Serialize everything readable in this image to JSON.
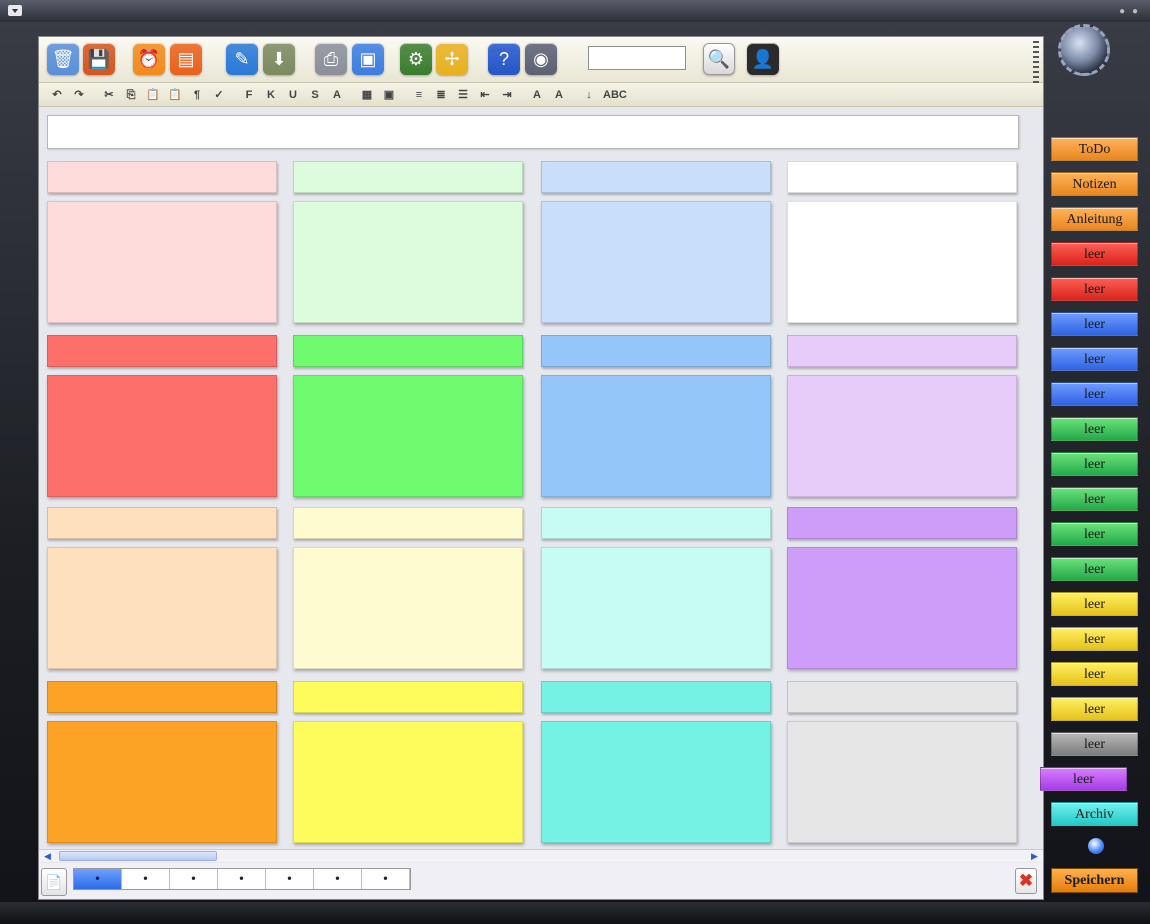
{
  "toolbar": {
    "icons": [
      {
        "name": "trash-icon",
        "glyph": "🗑",
        "color": "#5a8fd8"
      },
      {
        "name": "save-icon",
        "glyph": "💾",
        "color": "#d6551e"
      },
      {
        "name": "alarm-icon",
        "glyph": "⏰",
        "color": "#f28a1b"
      },
      {
        "name": "calendar-icon",
        "glyph": "▤",
        "color": "#e9621b"
      },
      {
        "name": "brush-icon",
        "glyph": "✎",
        "color": "#2a78d6"
      },
      {
        "name": "download-icon",
        "glyph": "⬇",
        "color": "#7b8a60"
      },
      {
        "name": "print-icon",
        "glyph": "⎙",
        "color": "#8a8f99"
      },
      {
        "name": "window-icon",
        "glyph": "▣",
        "color": "#3c7de0"
      },
      {
        "name": "settings-icon",
        "glyph": "⚙",
        "color": "#3b7d2e"
      },
      {
        "name": "fullscreen-icon",
        "glyph": "✢",
        "color": "#e7b01f"
      },
      {
        "name": "help-icon",
        "glyph": "?",
        "color": "#2456c9"
      },
      {
        "name": "globe-icon",
        "glyph": "◉",
        "color": "#5b6073"
      }
    ],
    "search_value": "",
    "search_button_glyph": "🔍",
    "user_glyph": "👤",
    "format_icons": [
      "↶",
      "↷",
      "✂",
      "⎘",
      "📋",
      "📋",
      "¶",
      "✓",
      "F",
      "K",
      "U",
      "S",
      "A",
      "▦",
      "▣",
      "≡",
      "≣",
      "☰",
      "⇤",
      "⇥",
      "A",
      "A",
      "↓",
      "ABC"
    ]
  },
  "notes": {
    "colors": [
      [
        "#ffdcdc",
        "#ddfcdd",
        "#c8defa",
        "#ffffff"
      ],
      [
        "#fd6f6a",
        "#6ffb6f",
        "#94c6fa",
        "#e7cbf9"
      ],
      [
        "#fee0bd",
        "#fffbd1",
        "#c7fcf4",
        "#ce9df9"
      ],
      [
        "#fca224",
        "#fefb5c",
        "#75f2e3",
        "#e6e6e6"
      ]
    ]
  },
  "footer": {
    "newpage_glyph": "📄",
    "pages": [
      "•",
      "•",
      "•",
      "•",
      "•",
      "•",
      "•"
    ],
    "delete_glyph": "✖"
  },
  "sidebar": {
    "buttons": [
      {
        "label": "ToDo",
        "style": "orange"
      },
      {
        "label": "Notizen",
        "style": "orange"
      },
      {
        "label": "Anleitung",
        "style": "orange"
      },
      {
        "label": "leer",
        "style": "red"
      },
      {
        "label": "leer",
        "style": "red"
      },
      {
        "label": "leer",
        "style": "blue"
      },
      {
        "label": "leer",
        "style": "blue"
      },
      {
        "label": "leer",
        "style": "blue"
      },
      {
        "label": "leer",
        "style": "green"
      },
      {
        "label": "leer",
        "style": "green"
      },
      {
        "label": "leer",
        "style": "green"
      },
      {
        "label": "leer",
        "style": "green"
      },
      {
        "label": "leer",
        "style": "green"
      },
      {
        "label": "leer",
        "style": "yellow"
      },
      {
        "label": "leer",
        "style": "yellow"
      },
      {
        "label": "leer",
        "style": "yellow"
      },
      {
        "label": "leer",
        "style": "yellow"
      },
      {
        "label": "leer",
        "style": "gray"
      },
      {
        "label": "leer",
        "style": "purple"
      },
      {
        "label": "Archiv",
        "style": "cyan"
      }
    ],
    "save_label": "Speichern"
  }
}
